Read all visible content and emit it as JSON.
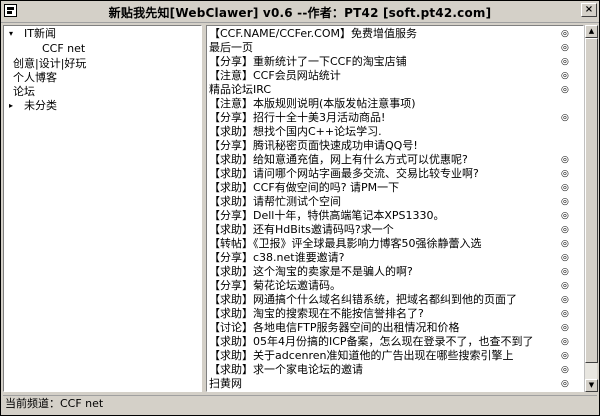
{
  "window": {
    "title": "新贴我先知[WebClawer] v0.6 --作者：PT42 [soft.pt42.com]",
    "close_label": "×"
  },
  "tree": {
    "items": [
      {
        "label": "IT新闻",
        "expander": "▾"
      },
      {
        "label": "CCF net"
      },
      {
        "label": "创意|设计|好玩"
      },
      {
        "label": "个人博客"
      },
      {
        "label": "论坛"
      },
      {
        "label": "未分类",
        "expander": "▸"
      }
    ]
  },
  "list": {
    "mark_symbol": "◎",
    "rows": [
      {
        "text": "【CCF.NAME/CCFer.COM】免费增值服务",
        "marked": true
      },
      {
        "text": "最后一页",
        "marked": true
      },
      {
        "text": "【分享】重新统计了一下CCF的淘宝店铺",
        "marked": true
      },
      {
        "text": "【注意】CCF会员网站统计",
        "marked": true
      },
      {
        "text": "精品论坛IRC",
        "marked": true
      },
      {
        "text": "【注意】本版规则说明(本版发帖注意事项)",
        "marked": false
      },
      {
        "text": "【分享】招行十全十美3月活动商品!",
        "marked": true
      },
      {
        "text": "【求助】想找个国内C++论坛学习.",
        "marked": false
      },
      {
        "text": "【分享】腾讯秘密页面快速成功申请QQ号!",
        "marked": false
      },
      {
        "text": "【求助】给知意通充值，网上有什么方式可以优惠呢?",
        "marked": true
      },
      {
        "text": "【求助】请问哪个网站字画最多交流、交易比较专业啊?",
        "marked": true
      },
      {
        "text": "【求助】CCF有做空间的吗? 请PM一下",
        "marked": true
      },
      {
        "text": "【求助】请帮忙测试个空间",
        "marked": true
      },
      {
        "text": "【分享】Dell十年，特供高端笔记本XPS1330。",
        "marked": true
      },
      {
        "text": "【求助】还有HdBits邀请码吗?求一个",
        "marked": true
      },
      {
        "text": "【转帖】《卫报》评全球最具影响力博客50强徐静蕾入选",
        "marked": true
      },
      {
        "text": "【分享】c38.net谁要邀请?",
        "marked": true
      },
      {
        "text": "【求助】这个淘宝的卖家是不是骗人的啊?",
        "marked": true
      },
      {
        "text": "【分享】菊花论坛邀请码。",
        "marked": true
      },
      {
        "text": "【求助】网通搞个什么域名纠错系统，把域名都纠到他的页面了",
        "marked": true
      },
      {
        "text": "【求助】淘宝的搜索现在不能按信誉排名了?",
        "marked": true
      },
      {
        "text": "【讨论】各地电信FTP服务器空间的出租情况和价格",
        "marked": true
      },
      {
        "text": "【求助】05年4月份搞的ICP备案，怎么现在登录不了，也查不到了",
        "marked": true
      },
      {
        "text": "【求助】关于adcenren准知道他的广告出现在哪些搜索引擎上",
        "marked": true
      },
      {
        "text": "【求助】求一个家电论坛的邀请",
        "marked": true
      },
      {
        "text": "扫黄网",
        "marked": true
      }
    ]
  },
  "scrollbar": {
    "up": "▲",
    "down": "▼"
  },
  "status": {
    "text": "当前频道：CCF net"
  }
}
